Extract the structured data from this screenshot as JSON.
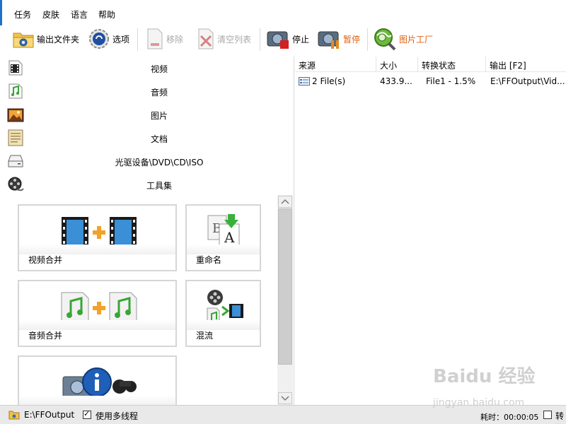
{
  "menu": {
    "items": [
      "任务",
      "皮肤",
      "语言",
      "帮助"
    ]
  },
  "toolbar": {
    "output_folder": "输出文件夹",
    "options": "选项",
    "remove": "移除",
    "clear_list": "清空列表",
    "stop": "停止",
    "pause": "暂停",
    "picture_factory": "图片工厂"
  },
  "categories": [
    "视频",
    "音频",
    "图片",
    "文档",
    "光驱设备\\DVD\\CD\\ISO",
    "工具集"
  ],
  "tools": {
    "video_join": "视频合并",
    "rename": "重命名",
    "audio_join": "音频合并",
    "mux": "混流"
  },
  "table": {
    "headers": [
      "来源",
      "大小",
      "转换状态",
      "输出 [F2]"
    ],
    "rows": [
      {
        "source": "2 File(s)",
        "size": "433.9...",
        "status": "File1 - 1.5%",
        "output": "E:\\FFOutput\\Vid..."
      }
    ]
  },
  "statusbar": {
    "path": "E:\\FFOutput",
    "multithread_label": "使用多线程",
    "multithread_checked": true,
    "elapsed": "耗时：00:00:05",
    "truncated_label": "转换"
  },
  "watermark": {
    "brand": "Baidu 经验",
    "url": "jingyan.baidu.com"
  },
  "colors": {
    "accent": "#1e73c9",
    "orange": "#e06010",
    "status_bg": "#e9e9e9"
  }
}
